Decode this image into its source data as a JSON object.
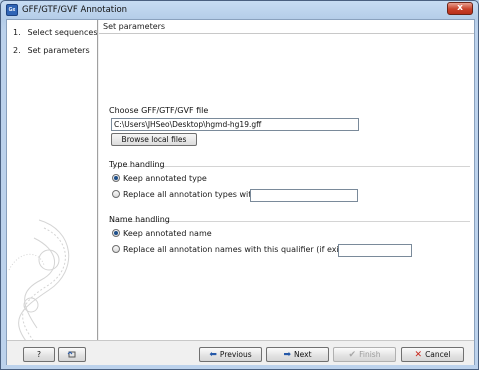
{
  "window": {
    "title": "GFF/GTF/GVF Annotation",
    "icon": "Gx",
    "close": "x"
  },
  "sidebar": {
    "steps": [
      {
        "num": "1.",
        "label": "Select sequences"
      },
      {
        "num": "2.",
        "label": "Set parameters"
      }
    ]
  },
  "main": {
    "panel_title": "Set parameters",
    "file_group": {
      "label": "Choose GFF/GTF/GVF file",
      "file_path": "C:\\Users\\JHSeo\\Desktop\\hgmd-hg19.gff",
      "browse_label": "Browse local files"
    },
    "type_group": {
      "label": "Type handling",
      "options": [
        {
          "label": "Keep annotated type",
          "checked": true
        },
        {
          "label": "Replace all annotation types with:",
          "checked": false
        }
      ],
      "replace_value": ""
    },
    "name_group": {
      "label": "Name handling",
      "options": [
        {
          "label": "Keep annotated name",
          "checked": true
        },
        {
          "label": "Replace all annotation names with this qualifier (if exists):",
          "checked": false
        }
      ],
      "replace_value": ""
    }
  },
  "footer": {
    "help_label": "?",
    "previous_label": "Previous",
    "next_label": "Next",
    "finish_label": "Finish",
    "cancel_label": "Cancel"
  },
  "colors": {
    "title_bar": "#bcd2ec",
    "close_button": "#c8412a",
    "radio_dot": "#1e4f8a"
  },
  "icons": {
    "app": "app-logo-icon",
    "help": "question-icon",
    "restore": "restore-defaults-icon",
    "previous": "arrow-left-icon",
    "next": "arrow-right-icon",
    "finish": "checkmark-icon",
    "cancel": "x-icon"
  }
}
